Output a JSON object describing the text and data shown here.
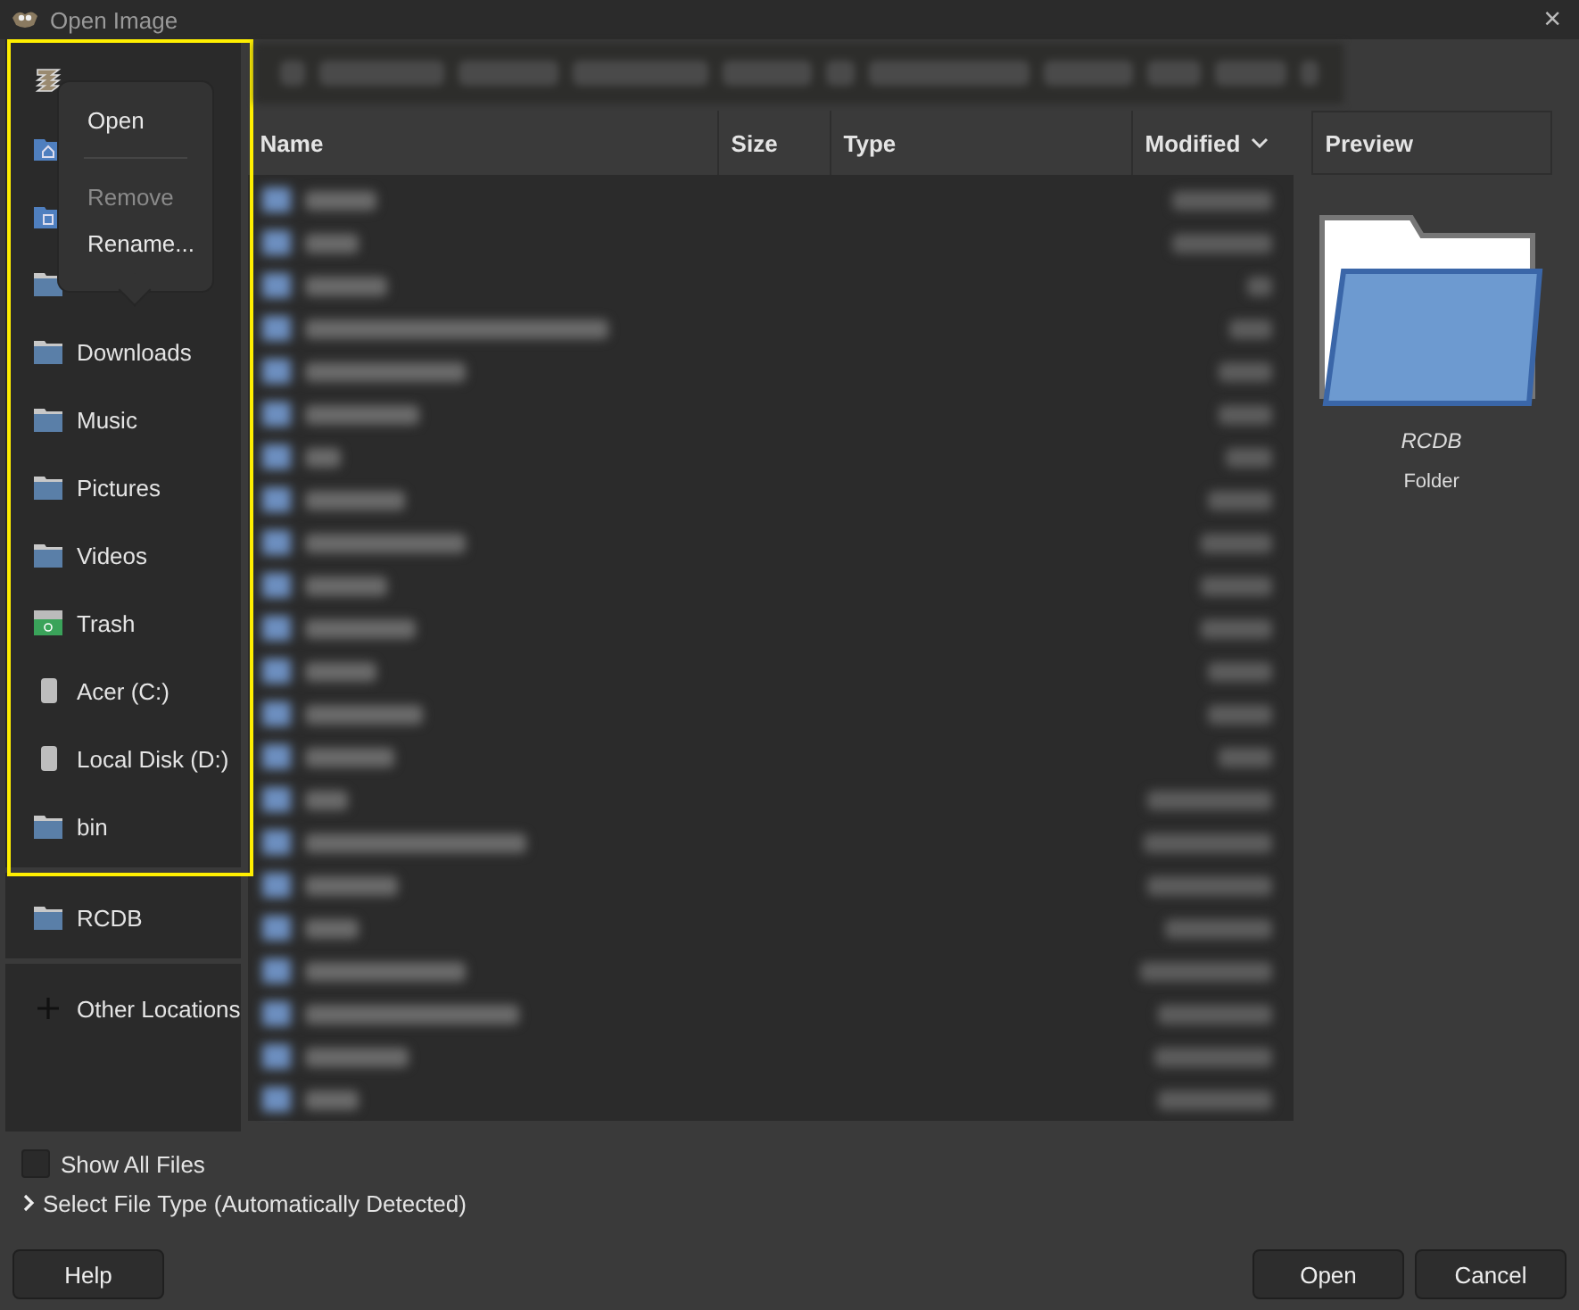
{
  "window": {
    "title": "Open Image",
    "close": "×"
  },
  "sidebar": {
    "groups": [
      {
        "items": [
          {
            "kind": "recent"
          },
          {
            "kind": "home"
          },
          {
            "kind": "documents"
          },
          {
            "kind": "folder"
          },
          {
            "kind": "folder",
            "label": "Downloads"
          },
          {
            "kind": "folder",
            "label": "Music"
          },
          {
            "kind": "folder",
            "label": "Pictures"
          },
          {
            "kind": "folder",
            "label": "Videos"
          },
          {
            "kind": "trash",
            "label": "Trash"
          },
          {
            "kind": "drive",
            "label": "Acer (C:)"
          },
          {
            "kind": "drive",
            "label": "Local Disk (D:)"
          },
          {
            "kind": "folder",
            "label": "bin"
          }
        ]
      },
      {
        "items": [
          {
            "kind": "folder",
            "label": "RCDB"
          }
        ]
      },
      {
        "items": [
          {
            "kind": "add",
            "label": "Other Locations"
          }
        ]
      }
    ]
  },
  "popover_menu": {
    "items": [
      {
        "label": "Open",
        "disabled": false
      },
      {
        "label": "Remove",
        "disabled": true
      },
      {
        "label": "Rename...",
        "disabled": false
      }
    ]
  },
  "columns": [
    {
      "label": "Name",
      "sorted": false
    },
    {
      "label": "Size",
      "sorted": false
    },
    {
      "label": "Type",
      "sorted": false
    },
    {
      "label": "Modified",
      "sorted": true
    }
  ],
  "preview": {
    "heading": "Preview",
    "name": "RCDB",
    "type": "Folder"
  },
  "show_all_files": {
    "label": "Show All Files",
    "checked": false
  },
  "file_type": {
    "label": "Select File Type (Automatically Detected)",
    "expanded": false
  },
  "buttons": {
    "help": "Help",
    "open": "Open",
    "cancel": "Cancel"
  }
}
